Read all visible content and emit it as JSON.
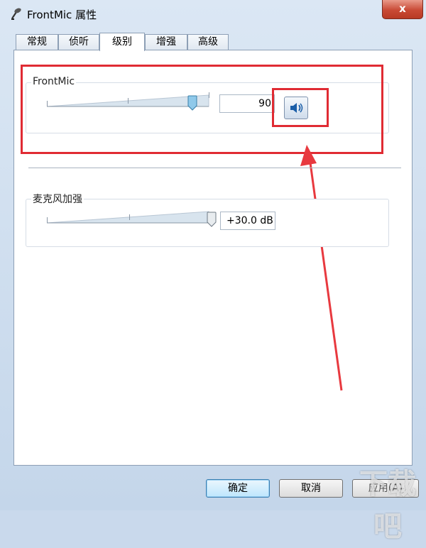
{
  "window": {
    "title": "FrontMic 属性",
    "close_label": "x"
  },
  "tabs": [
    {
      "label": "常规",
      "active": false
    },
    {
      "label": "侦听",
      "active": false
    },
    {
      "label": "级别",
      "active": true
    },
    {
      "label": "增强",
      "active": false
    },
    {
      "label": "高级",
      "active": false
    }
  ],
  "levels": {
    "frontmic": {
      "label": "FrontMic",
      "value": "90",
      "level_fraction": 0.9,
      "mute_icon": "speaker-icon"
    },
    "boost": {
      "label": "麦克风加强",
      "value": "+30.0 dB",
      "level_fraction": 1.0
    }
  },
  "buttons": {
    "ok": "确定",
    "cancel": "取消",
    "apply": "应用(A)"
  },
  "annotation": {
    "color": "#e02b33"
  },
  "watermark": "下载吧"
}
